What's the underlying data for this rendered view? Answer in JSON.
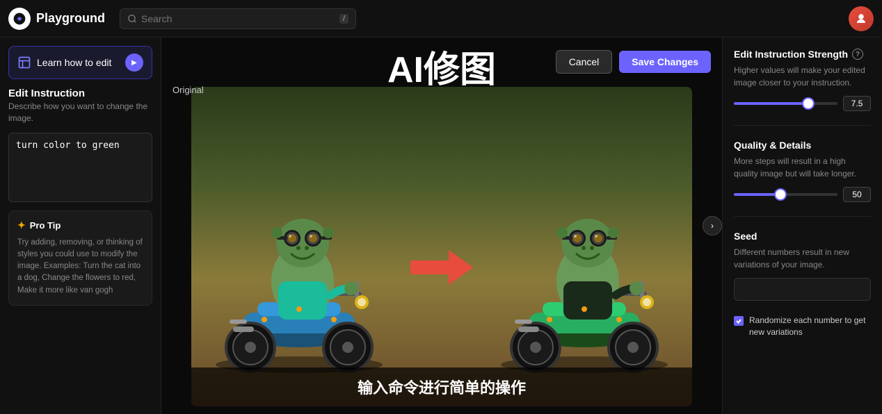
{
  "header": {
    "logo_text": "Playground",
    "search_placeholder": "Search",
    "slash_key": "/"
  },
  "sidebar_left": {
    "learn_btn_label": "Learn how to edit",
    "edit_instruction_title": "Edit Instruction",
    "edit_instruction_desc": "Describe how you want to change the image.",
    "edit_instruction_value": "turn color to green",
    "pro_tip_title": "Pro Tip",
    "pro_tip_text": "Try adding, removing, or thinking of styles you could use to modify the image. Examples: Turn the cat into a dog, Change the flowers to red, Make it more like van gogh"
  },
  "canvas": {
    "main_title": "AI修图",
    "original_label": "Original",
    "cancel_label": "Cancel",
    "save_label": "Save Changes",
    "subtitle": "输入命令进行简单的操作"
  },
  "sidebar_right": {
    "strength_title": "Edit Instruction Strength",
    "strength_desc": "Higher values will make your edited image closer to your instruction.",
    "strength_value": "7.5",
    "strength_percent": 72,
    "quality_title": "Quality & Details",
    "quality_desc": "More steps will result in a high quality image but will take longer.",
    "quality_value": "50",
    "quality_percent": 45,
    "seed_title": "Seed",
    "seed_desc": "Different numbers result in new variations of your image.",
    "seed_placeholder": "",
    "randomize_label": "Randomize each number to get new variations"
  }
}
